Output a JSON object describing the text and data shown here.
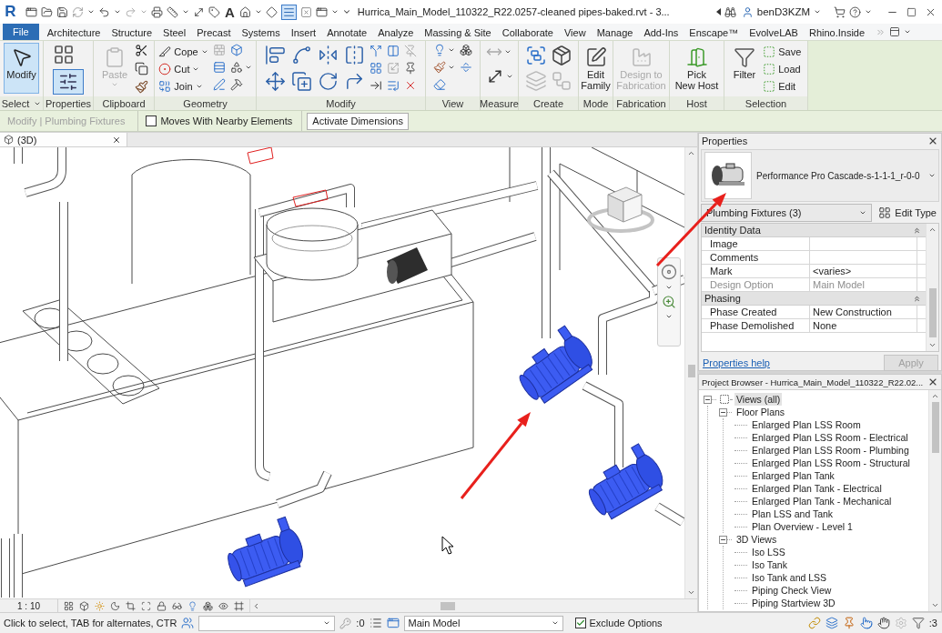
{
  "title_bar": {
    "logo": "R",
    "text_tool": "A",
    "thin_lines": {
      "on": true
    },
    "title": "Hurrica_Main_Model_110322_R22.0257-cleaned pipes-baked.rvt - 3...",
    "user": "benD3KZM"
  },
  "ribbon_tabs": {
    "file": "File",
    "tabs": [
      {
        "label": "Architecture",
        "selected": false
      },
      {
        "label": "Structure",
        "selected": false
      },
      {
        "label": "Steel",
        "selected": false
      },
      {
        "label": "Precast",
        "selected": false
      },
      {
        "label": "Systems",
        "selected": false
      },
      {
        "label": "Insert",
        "selected": false
      },
      {
        "label": "Annotate",
        "selected": false
      },
      {
        "label": "Analyze",
        "selected": false
      },
      {
        "label": "Massing & Site",
        "selected": false
      },
      {
        "label": "Collaborate",
        "selected": false
      },
      {
        "label": "View",
        "selected": false
      },
      {
        "label": "Manage",
        "selected": false
      },
      {
        "label": "Add-Ins",
        "selected": false
      },
      {
        "label": "Enscape™",
        "selected": false
      },
      {
        "label": "EvolveLAB",
        "selected": false
      },
      {
        "label": "Rhino.Inside",
        "selected": false
      }
    ]
  },
  "ribbon": {
    "panels": [
      {
        "kind": "select",
        "title": "Select",
        "menu": true,
        "button": {
          "label": "Modify",
          "selected": true
        }
      },
      {
        "kind": "properties",
        "title": "Properties",
        "toggle": {
          "on": true
        }
      },
      {
        "kind": "clipboard",
        "title": "Clipboard",
        "button": {
          "label": "Paste",
          "disabled": true
        }
      },
      {
        "kind": "geometry",
        "title": "Geometry",
        "tools": [
          {
            "label": "Cope"
          },
          {
            "label": "Cut"
          },
          {
            "label": "Join"
          }
        ]
      },
      {
        "kind": "modify",
        "title": "Modify"
      },
      {
        "kind": "view",
        "title": "View"
      },
      {
        "kind": "measure",
        "title": "Measure"
      },
      {
        "kind": "create",
        "title": "Create"
      },
      {
        "kind": "mode",
        "title": "Mode",
        "button": {
          "label": "Edit\nFamily",
          "disabled": false
        }
      },
      {
        "kind": "fabrication",
        "title": "Fabrication",
        "button": {
          "label": "Design to\nFabrication",
          "disabled": true
        }
      },
      {
        "kind": "host",
        "title": "Host",
        "button": {
          "label": "Pick\nNew Host",
          "disabled": false
        }
      },
      {
        "kind": "selection",
        "title": "Selection",
        "button": {
          "label": "Filter",
          "disabled": false
        },
        "tools": [
          {
            "label": "Save"
          },
          {
            "label": "Load"
          },
          {
            "label": "Edit"
          }
        ]
      }
    ]
  },
  "options_bar": {
    "context": "Modify | Plumbing Fixtures",
    "moves_with_nearby": {
      "label": "Moves With Nearby Elements",
      "checked": false
    },
    "activate_dimensions": "Activate Dimensions"
  },
  "view_tabs": [
    {
      "label": "(3D)",
      "selected": true
    }
  ],
  "view_controls": {
    "scale": "1 : 10"
  },
  "properties": {
    "title": "Properties",
    "type_name": "Performance Pro Cascade-s-1-1-1_r-0-0",
    "filter": "Plumbing Fixtures (3)",
    "edit_type": "Edit Type",
    "groups": [
      {
        "name": "Identity Data",
        "expanded": true,
        "rows": [
          {
            "label": "Image",
            "disabled": false
          },
          {
            "label": "Comments",
            "disabled": false
          },
          {
            "label": "Mark",
            "value": "<varies>",
            "disabled": false
          },
          {
            "label": "Design Option",
            "value": "Main Model",
            "disabled": true
          }
        ]
      },
      {
        "name": "Phasing",
        "expanded": true,
        "rows": [
          {
            "label": "Phase Created",
            "value": "New Construction",
            "disabled": false
          },
          {
            "label": "Phase Demolished",
            "value": "None",
            "disabled": false
          }
        ]
      }
    ],
    "help_link": "Properties help",
    "apply": {
      "label": "Apply",
      "disabled": true
    }
  },
  "project_browser": {
    "title": "Project Browser - Hurrica_Main_Model_110322_R22.02...",
    "tree": [
      {
        "label": "Views (all)",
        "selected": true,
        "expanded": true,
        "children": [
          {
            "label": "Floor Plans",
            "selected": false,
            "expanded": true,
            "children": [
              {
                "label": "Enlarged Plan LSS Room",
                "selected": false
              },
              {
                "label": "Enlarged Plan LSS Room - Electrical",
                "selected": false
              },
              {
                "label": "Enlarged Plan LSS Room - Plumbing",
                "selected": false
              },
              {
                "label": "Enlarged Plan LSS Room - Structural",
                "selected": false
              },
              {
                "label": "Enlarged Plan Tank",
                "selected": false
              },
              {
                "label": "Enlarged Plan Tank - Electrical",
                "selected": false
              },
              {
                "label": "Enlarged Plan Tank - Mechanical",
                "selected": false
              },
              {
                "label": "Plan LSS and Tank",
                "selected": false
              },
              {
                "label": "Plan Overview - Level 1",
                "selected": false
              }
            ]
          },
          {
            "label": "3D Views",
            "selected": false,
            "expanded": true,
            "children": [
              {
                "label": "Iso LSS",
                "selected": false
              },
              {
                "label": "Iso Tank",
                "selected": false
              },
              {
                "label": "Iso Tank and LSS",
                "selected": false
              },
              {
                "label": "Piping Check View",
                "selected": false
              },
              {
                "label": "Piping Startview 3D",
                "selected": false
              }
            ]
          }
        ]
      }
    ]
  },
  "status_bar": {
    "message": "Click to select, TAB for alternates, CTR",
    "editable_count": ":0",
    "design_option": "Main Model",
    "exclude_options": {
      "label": "Exclude Options",
      "checked": true
    },
    "selection_count": ":3"
  }
}
